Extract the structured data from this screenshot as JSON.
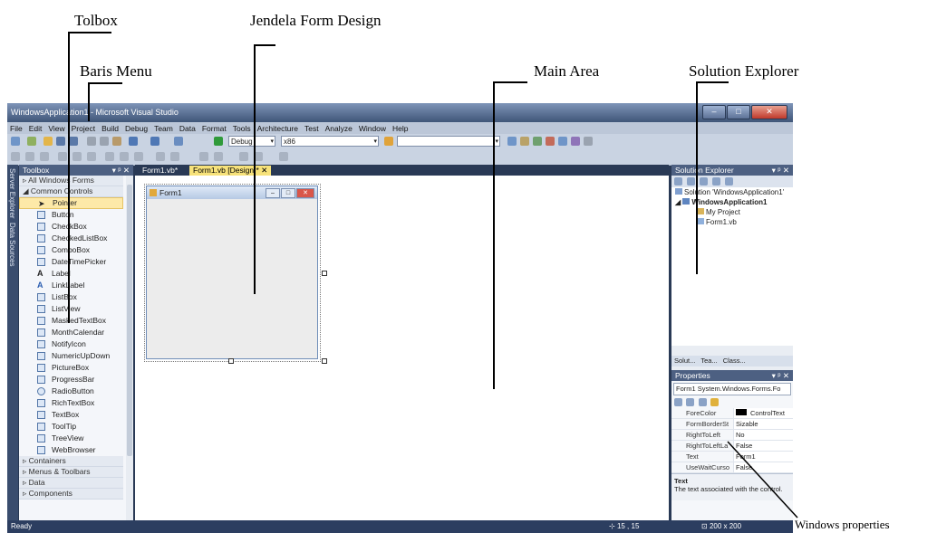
{
  "annotations": {
    "toolbox": "Tolbox",
    "form_design": "Jendela Form Design",
    "menu_bar": "Baris Menu",
    "main_area": "Main Area",
    "solution_explorer": "Solution Explorer",
    "windows_properties": "Windows properties"
  },
  "window": {
    "title": "WindowsApplication1 - Microsoft Visual Studio"
  },
  "menu": [
    "File",
    "Edit",
    "View",
    "Project",
    "Build",
    "Debug",
    "Team",
    "Data",
    "Format",
    "Tools",
    "Architecture",
    "Test",
    "Analyze",
    "Window",
    "Help"
  ],
  "toolbar": {
    "config": "Debug",
    "platform": "x86"
  },
  "side_tabs": [
    "Server Explorer",
    "Data Sources"
  ],
  "toolbox": {
    "title": "Toolbox",
    "sections_top": [
      "All Windows Forms",
      "Common Controls"
    ],
    "items": [
      "Pointer",
      "Button",
      "CheckBox",
      "CheckedListBox",
      "ComboBox",
      "DateTimePicker",
      "Label",
      "LinkLabel",
      "ListBox",
      "ListView",
      "MaskedTextBox",
      "MonthCalendar",
      "NotifyIcon",
      "NumericUpDown",
      "PictureBox",
      "ProgressBar",
      "RadioButton",
      "RichTextBox",
      "TextBox",
      "ToolTip",
      "TreeView",
      "WebBrowser"
    ],
    "sections_bottom": [
      "Containers",
      "Menus & Toolbars",
      "Data",
      "Components"
    ]
  },
  "tabs": [
    "Form1.vb*",
    "Form1.vb [Design]*"
  ],
  "form": {
    "title": "Form1"
  },
  "solution": {
    "title": "Solution Explorer",
    "nodes": [
      "Solution 'WindowsApplication1'",
      "WindowsApplication1",
      "My Project",
      "Form1.vb"
    ],
    "tabs": [
      "Solut...",
      "Tea...",
      "Class..."
    ]
  },
  "properties": {
    "title": "Properties",
    "object": "Form1 System.Windows.Forms.Fo",
    "rows": [
      {
        "name": "ForeColor",
        "value": "ControlText"
      },
      {
        "name": "FormBorderSt",
        "value": "Sizable"
      },
      {
        "name": "RightToLeft",
        "value": "No"
      },
      {
        "name": "RightToLeftLa",
        "value": "False"
      },
      {
        "name": "Text",
        "value": "Form1"
      },
      {
        "name": "UseWaitCurso",
        "value": "False"
      }
    ],
    "desc_title": "Text",
    "desc_text": "The text associated with the control."
  },
  "status": {
    "text": "Ready",
    "pos": "15 , 15",
    "size": "200 x 200"
  },
  "colors": {
    "chrome": "#293955",
    "panel_header": "#4d6082",
    "active_tab": "#f7e27a",
    "selection": "#fde9a8"
  }
}
